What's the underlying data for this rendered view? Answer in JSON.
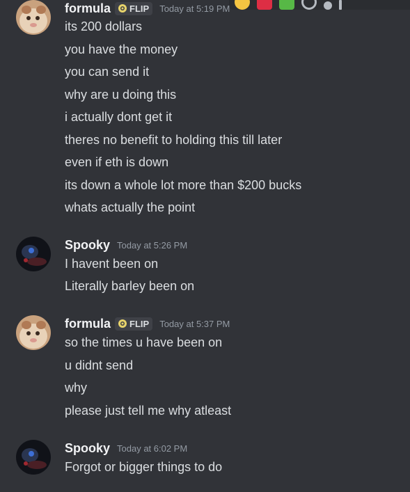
{
  "messages": [
    {
      "author": "formula",
      "tag": "FLIP",
      "timestamp": "Today at 5:19 PM",
      "lines": [
        "its 200 dollars",
        "you have the money",
        "you can send it",
        "why are u doing this",
        "i actually dont get it",
        "theres no benefit to holding this till later",
        "even if eth is down",
        "its down a whole lot more than $200 bucks",
        "whats actually the point"
      ]
    },
    {
      "author": "Spooky",
      "timestamp": "Today at 5:26 PM",
      "lines": [
        "I havent been on",
        "Literally barley been on"
      ]
    },
    {
      "author": "formula",
      "tag": "FLIP",
      "timestamp": "Today at 5:37 PM",
      "lines": [
        "so the times u have been on",
        "u didnt send",
        "why",
        "please just tell me why atleast"
      ]
    },
    {
      "author": "Spooky",
      "timestamp": "Today at 6:02 PM",
      "lines": [
        "Forgot or bigger things to do"
      ]
    }
  ],
  "toolbar_icons": [
    "emoji-reaction-icon",
    "heart-reaction-icon",
    "check-reaction-icon",
    "react-icon",
    "reply-icon",
    "more-icon"
  ],
  "colors": {
    "background": "#313338",
    "username": "#f2f3f5",
    "text": "#dbdee1",
    "timestamp": "#949ba4",
    "tag_bg": "#3f4147"
  }
}
